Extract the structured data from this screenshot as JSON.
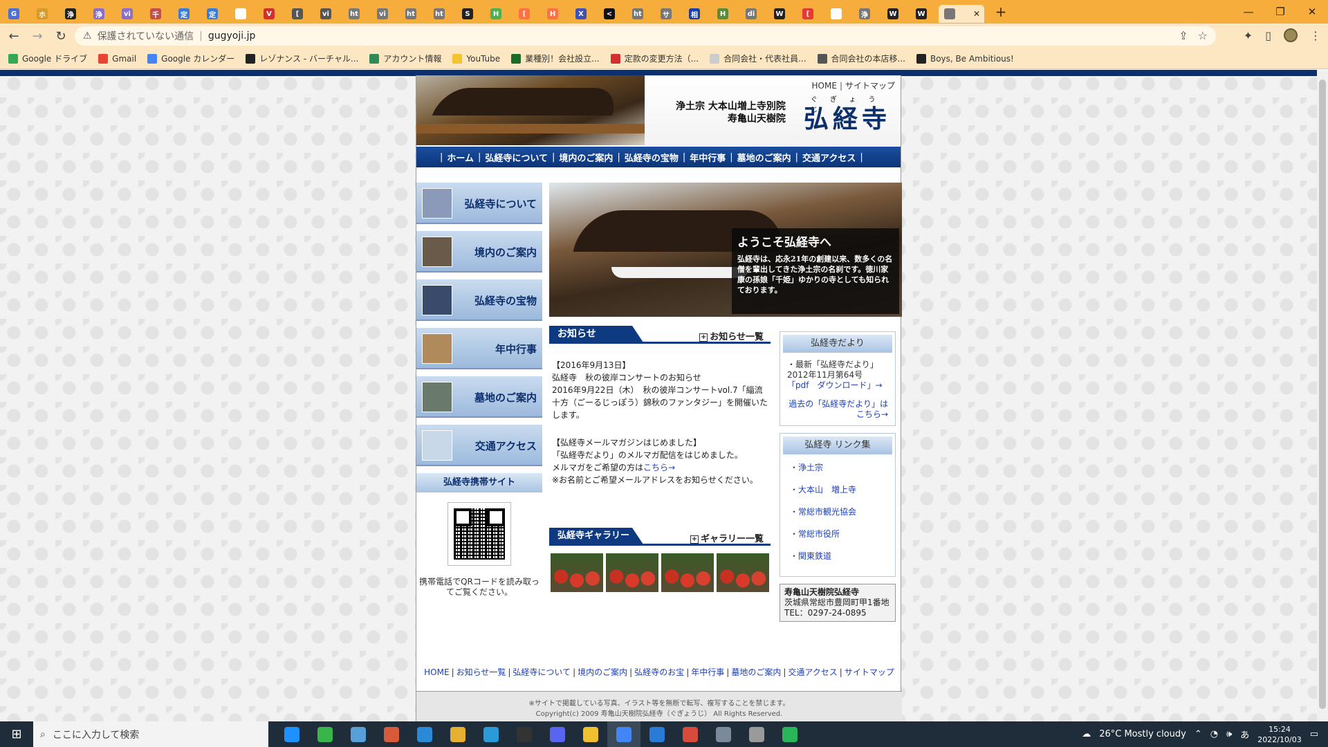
{
  "browser": {
    "tabs": [
      {
        "label": "G",
        "color": "#4a6fd6"
      },
      {
        "label": "ホ",
        "color": "#d59a2a"
      },
      {
        "label": "浄",
        "color": "#222222"
      },
      {
        "label": "浄",
        "color": "#8a6fc8"
      },
      {
        "label": "vi",
        "color": "#8a6fc8"
      },
      {
        "label": "千",
        "color": "#c0504d"
      },
      {
        "label": "定",
        "color": "#3a7bd5"
      },
      {
        "label": "定",
        "color": "#3a7bd5"
      },
      {
        "label": "H",
        "color": "#ffffff"
      },
      {
        "label": "V",
        "color": "#d32f2f"
      },
      {
        "label": "[",
        "color": "#555555"
      },
      {
        "label": "vi",
        "color": "#555555"
      },
      {
        "label": "ht",
        "color": "#777777"
      },
      {
        "label": "vi",
        "color": "#777777"
      },
      {
        "label": "ht",
        "color": "#777777"
      },
      {
        "label": "ht",
        "color": "#777777"
      },
      {
        "label": "S",
        "color": "#222222"
      },
      {
        "label": "H",
        "color": "#4caf50"
      },
      {
        "label": "[",
        "color": "#ff7043"
      },
      {
        "label": "H",
        "color": "#ff7043"
      },
      {
        "label": "X",
        "color": "#3f51b5"
      },
      {
        "label": "<",
        "color": "#111111"
      },
      {
        "label": "ht",
        "color": "#777777"
      },
      {
        "label": "サ",
        "color": "#777777"
      },
      {
        "label": "相",
        "color": "#1a3fa8"
      },
      {
        "label": "H",
        "color": "#5a8a3a"
      },
      {
        "label": "di",
        "color": "#777777"
      },
      {
        "label": "W",
        "color": "#222222"
      },
      {
        "label": "[",
        "color": "#e53935"
      },
      {
        "label": "H",
        "color": "#ffffff"
      },
      {
        "label": "浄",
        "color": "#777777"
      },
      {
        "label": "W",
        "color": "#222222"
      },
      {
        "label": "W",
        "color": "#222222"
      }
    ],
    "active_tab_label": "",
    "new_tab": "+",
    "window_controls": {
      "min": "—",
      "max": "❐",
      "close": "✕"
    },
    "security_label": "保護されていない通信",
    "url": "gugyoji.jp",
    "bookmarks": [
      {
        "label": "Google ドライブ",
        "color": "#34a853"
      },
      {
        "label": "Gmail",
        "color": "#ea4335"
      },
      {
        "label": "Google カレンダー",
        "color": "#4285f4"
      },
      {
        "label": "レゾナンス - バーチャル...",
        "color": "#222222"
      },
      {
        "label": "アカウント情報",
        "color": "#2e8b57"
      },
      {
        "label": "YouTube",
        "color": "#f4c430"
      },
      {
        "label": "業種別！会社設立...",
        "color": "#1a6a2a"
      },
      {
        "label": "定款の変更方法（...",
        "color": "#d32f2f"
      },
      {
        "label": "合同会社・代表社員...",
        "color": "#cccccc"
      },
      {
        "label": "合同会社の本店移...",
        "color": "#555555"
      },
      {
        "label": "Boys, Be Ambitious!",
        "color": "#222222"
      }
    ]
  },
  "site": {
    "top_links": [
      "HOME",
      "サイトマップ"
    ],
    "sect_line1": "浄土宗 大本山増上寺別院",
    "sect_line2": "寿亀山天樹院",
    "temple_name": "弘経寺",
    "temple_ruby": "ぐぎょうじ",
    "global_nav": [
      "ホーム",
      "弘経寺について",
      "境内のご案内",
      "弘経寺の宝物",
      "年中行事",
      "墓地のご案内",
      "交通アクセス"
    ],
    "side_buttons": [
      {
        "label": "弘経寺について",
        "thumb": "#8a9ab8"
      },
      {
        "label": "境内のご案内",
        "thumb": "#6a5a4a"
      },
      {
        "label": "弘経寺の宝物",
        "thumb": "#3a4a6a"
      },
      {
        "label": "年中行事",
        "thumb": "#b08a5a"
      },
      {
        "label": "墓地のご案内",
        "thumb": "#6a7a6a"
      },
      {
        "label": "交通アクセス",
        "thumb": "#c8d8e8"
      }
    ],
    "mobile_title": "弘経寺携帯サイト",
    "qr_text": "携帯電話でQRコードを読み取ってご覧ください。",
    "hero_title": "ようこそ弘経寺へ",
    "hero_text": "弘経寺は、応永21年の創建以来、数多くの名僧を輩出してきた浄土宗の名刹です。徳川家康の孫娘「千姫」ゆかりの寺としても知られております。",
    "news_title": "お知らせ",
    "news_more": "お知らせ一覧",
    "news": [
      {
        "date": "【2016年9月13日】",
        "title": "弘経寺　秋の彼岸コンサートのお知らせ",
        "body": "2016年9月22日（木）　秋の彼岸コンサートvol.7「緇流十方（ごーるじっぽう）錦秋のファンタジー」を開催いたします。"
      },
      {
        "date": "【弘経寺メールマガジンはじめました】",
        "title": "「弘経寺だより」のメルマガ配信をはじめました。",
        "body": "メルマガをご希望の方は",
        "link": "こちら→",
        "note": "※お名前とご希望メールアドレスをお知らせください。"
      }
    ],
    "gallery_title": "弘経寺ギャラリー",
    "gallery_more": "ギャラリー一覧",
    "gallery_count": 4,
    "dayori": {
      "head": "弘経寺だより",
      "latest": "・最新「弘経寺だより」2012年11月第64号",
      "pdf": "「pdf　ダウンロード」→",
      "past": "過去の「弘経寺だより」はこちら→"
    },
    "links": {
      "head": "弘経寺 リンク集",
      "items": [
        "浄土宗",
        "大本山　増上寺",
        "常総市観光協会",
        "常総市役所",
        "関東鉄道"
      ]
    },
    "address": {
      "name": "寿亀山天樹院弘経寺",
      "addr": "茨城県常総市豊岡町甲1番地",
      "tel": "TEL：0297-24-0895"
    },
    "footer_nav": [
      "HOME",
      "お知らせ一覧",
      "弘経寺について",
      "境内のご案内",
      "弘経寺のお宝",
      "年中行事",
      "墓地のご案内",
      "交通アクセス",
      "サイトマップ"
    ],
    "footer_notice": "※サイトで掲載している写真、イラスト等を無断で転写、複写することを禁じます。",
    "copyright": "Copyright(c) 2009 寿亀山天樹院弘経寺（ぐぎょうじ） All Rights Reserved."
  },
  "taskbar": {
    "search_placeholder": "ここに入力して検索",
    "weather": "26°C  Mostly cloudy",
    "time": "15:24",
    "date": "2022/10/03",
    "ime": "あ",
    "apps": [
      "#1e90ff",
      "#3ab54a",
      "#5aa0d8",
      "#d85a3a",
      "#2a8ad8",
      "#e8b030",
      "#2a9ad8",
      "#333333",
      "#5865f2",
      "#f0c030",
      "#4285f4",
      "#2a7ad8",
      "#d84a3a",
      "#7a8a9a",
      "#9a9a9a",
      "#2ab55a"
    ]
  }
}
